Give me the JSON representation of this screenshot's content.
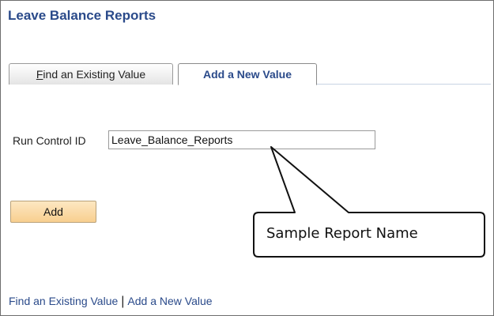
{
  "page": {
    "title": "Leave Balance Reports"
  },
  "tabs": [
    {
      "label_first": "F",
      "label_rest": "ind an Existing Value",
      "active": false
    },
    {
      "label": "Add a New Value",
      "active": true
    }
  ],
  "form": {
    "run_control_label": "Run Control ID",
    "run_control_value": "Leave_Balance_Reports",
    "add_button_label": "Add"
  },
  "callout": {
    "text": "Sample Report Name"
  },
  "footer": {
    "link_find": "Find an Existing Value",
    "separator": "|",
    "link_add": "Add a New Value"
  },
  "colors": {
    "title_blue": "#2a4a8a",
    "button_orange": "#f8cf8f"
  }
}
